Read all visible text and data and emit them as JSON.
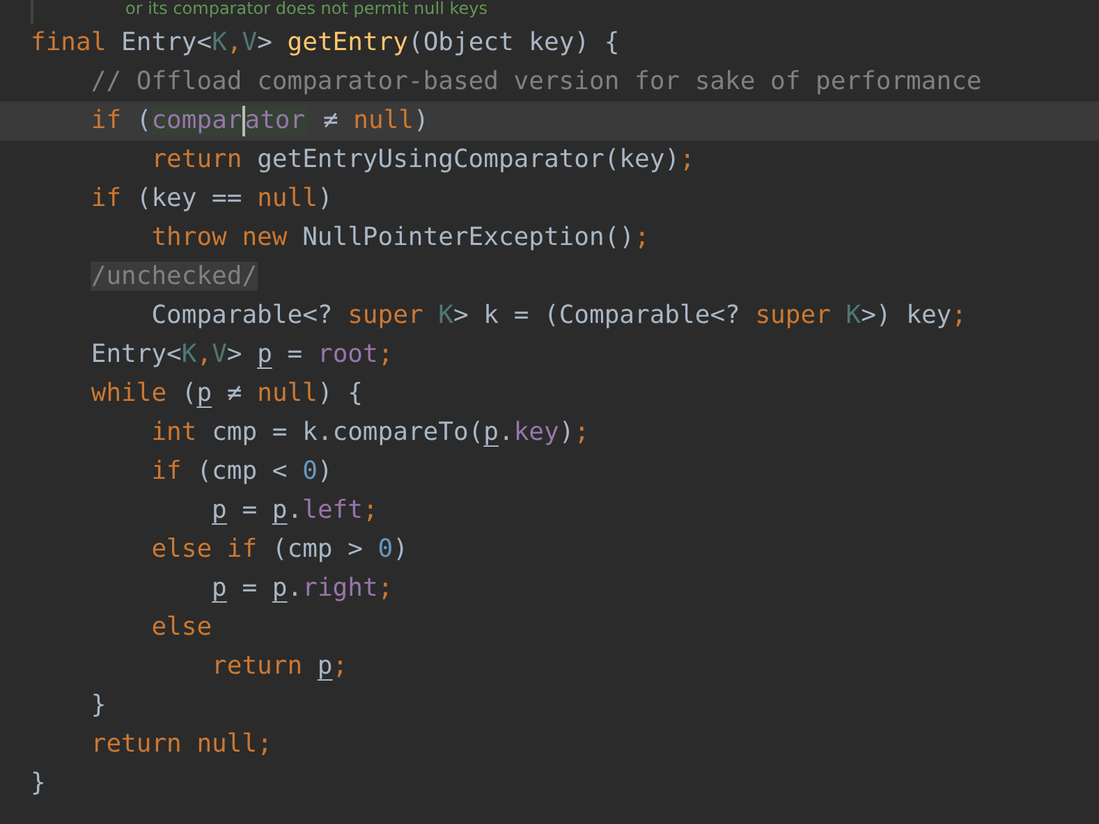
{
  "doc_fragment": "or its comparator does not permit null keys",
  "lines": [
    {
      "current": false,
      "tokens": [
        {
          "text": "final ",
          "kind": "kw"
        },
        {
          "text": "Entry<",
          "kind": "plain"
        },
        {
          "text": "K",
          "kind": "tparam"
        },
        {
          "text": ",",
          "kind": "kw"
        },
        {
          "text": "V",
          "kind": "tparam"
        },
        {
          "text": "> ",
          "kind": "plain"
        },
        {
          "text": "getEntry",
          "kind": "method"
        },
        {
          "text": "(Object key) {",
          "kind": "plain"
        }
      ]
    },
    {
      "current": false,
      "tokens": [
        {
          "text": "    // Offload comparator-based version for sake of performance",
          "kind": "comment"
        }
      ]
    },
    {
      "current": true,
      "tokens": [
        {
          "text": "    if ",
          "kind": "kw"
        },
        {
          "text": "(",
          "kind": "plain"
        },
        {
          "text": "compar",
          "kind": "match",
          "caret_after": true
        },
        {
          "text": "ator",
          "kind": "match",
          "caret_after": false
        },
        {
          "text": " ≠ ",
          "kind": "plain"
        },
        {
          "text": "null",
          "kind": "kw"
        },
        {
          "text": ")",
          "kind": "plain"
        }
      ]
    },
    {
      "current": false,
      "tokens": [
        {
          "text": "        return ",
          "kind": "kw"
        },
        {
          "text": "getEntryUsingComparator(key)",
          "kind": "plain"
        },
        {
          "text": ";",
          "kind": "kw"
        }
      ]
    },
    {
      "current": false,
      "tokens": [
        {
          "text": "    if ",
          "kind": "kw"
        },
        {
          "text": "(key == ",
          "kind": "plain"
        },
        {
          "text": "null",
          "kind": "kw"
        },
        {
          "text": ")",
          "kind": "plain"
        }
      ]
    },
    {
      "current": false,
      "tokens": [
        {
          "text": "        throw new ",
          "kind": "kw"
        },
        {
          "text": "NullPointerException()",
          "kind": "plain"
        },
        {
          "text": ";",
          "kind": "kw"
        }
      ]
    },
    {
      "current": false,
      "tokens": [
        {
          "text": "    /unchecked/",
          "kind": "fold"
        }
      ]
    },
    {
      "current": false,
      "tokens": [
        {
          "text": "        Comparable<? ",
          "kind": "plain"
        },
        {
          "text": "super ",
          "kind": "kw"
        },
        {
          "text": "K",
          "kind": "tparam"
        },
        {
          "text": "> k = (Comparable<? ",
          "kind": "plain"
        },
        {
          "text": "super ",
          "kind": "kw"
        },
        {
          "text": "K",
          "kind": "tparam"
        },
        {
          "text": ">) key",
          "kind": "plain"
        },
        {
          "text": ";",
          "kind": "kw"
        }
      ]
    },
    {
      "current": false,
      "tokens": [
        {
          "text": "    Entry<",
          "kind": "plain"
        },
        {
          "text": "K",
          "kind": "tparam"
        },
        {
          "text": ",",
          "kind": "kw"
        },
        {
          "text": "V",
          "kind": "tparam"
        },
        {
          "text": "> ",
          "kind": "plain"
        },
        {
          "text": "p",
          "kind": "local"
        },
        {
          "text": " = ",
          "kind": "plain"
        },
        {
          "text": "root",
          "kind": "field"
        },
        {
          "text": ";",
          "kind": "kw"
        }
      ]
    },
    {
      "current": false,
      "tokens": [
        {
          "text": "    while ",
          "kind": "kw"
        },
        {
          "text": "(",
          "kind": "plain"
        },
        {
          "text": "p",
          "kind": "local"
        },
        {
          "text": " ≠ ",
          "kind": "plain"
        },
        {
          "text": "null",
          "kind": "kw"
        },
        {
          "text": ") {",
          "kind": "plain"
        }
      ]
    },
    {
      "current": false,
      "tokens": [
        {
          "text": "        int ",
          "kind": "kw"
        },
        {
          "text": "cmp = k.compareTo(",
          "kind": "plain"
        },
        {
          "text": "p",
          "kind": "local"
        },
        {
          "text": ".",
          "kind": "plain"
        },
        {
          "text": "key",
          "kind": "field"
        },
        {
          "text": ")",
          "kind": "plain"
        },
        {
          "text": ";",
          "kind": "kw"
        }
      ]
    },
    {
      "current": false,
      "tokens": [
        {
          "text": "        if ",
          "kind": "kw"
        },
        {
          "text": "(cmp < ",
          "kind": "plain"
        },
        {
          "text": "0",
          "kind": "num"
        },
        {
          "text": ")",
          "kind": "plain"
        }
      ]
    },
    {
      "current": false,
      "tokens": [
        {
          "text": "            p",
          "kind": "local"
        },
        {
          "text": " = ",
          "kind": "plain"
        },
        {
          "text": "p",
          "kind": "local"
        },
        {
          "text": ".",
          "kind": "plain"
        },
        {
          "text": "left",
          "kind": "field"
        },
        {
          "text": ";",
          "kind": "kw"
        }
      ]
    },
    {
      "current": false,
      "tokens": [
        {
          "text": "        else if ",
          "kind": "kw"
        },
        {
          "text": "(cmp > ",
          "kind": "plain"
        },
        {
          "text": "0",
          "kind": "num"
        },
        {
          "text": ")",
          "kind": "plain"
        }
      ]
    },
    {
      "current": false,
      "tokens": [
        {
          "text": "            p",
          "kind": "local"
        },
        {
          "text": " = ",
          "kind": "plain"
        },
        {
          "text": "p",
          "kind": "local"
        },
        {
          "text": ".",
          "kind": "plain"
        },
        {
          "text": "right",
          "kind": "field"
        },
        {
          "text": ";",
          "kind": "kw"
        }
      ]
    },
    {
      "current": false,
      "tokens": [
        {
          "text": "        else",
          "kind": "kw"
        }
      ]
    },
    {
      "current": false,
      "tokens": [
        {
          "text": "            return ",
          "kind": "kw"
        },
        {
          "text": "p",
          "kind": "local"
        },
        {
          "text": ";",
          "kind": "kw"
        }
      ]
    },
    {
      "current": false,
      "tokens": [
        {
          "text": "    }",
          "kind": "plain"
        }
      ]
    },
    {
      "current": false,
      "tokens": [
        {
          "text": "    return null",
          "kind": "kw"
        },
        {
          "text": ";",
          "kind": "kw"
        }
      ]
    },
    {
      "current": false,
      "tokens": [
        {
          "text": "}",
          "kind": "plain"
        }
      ]
    }
  ]
}
